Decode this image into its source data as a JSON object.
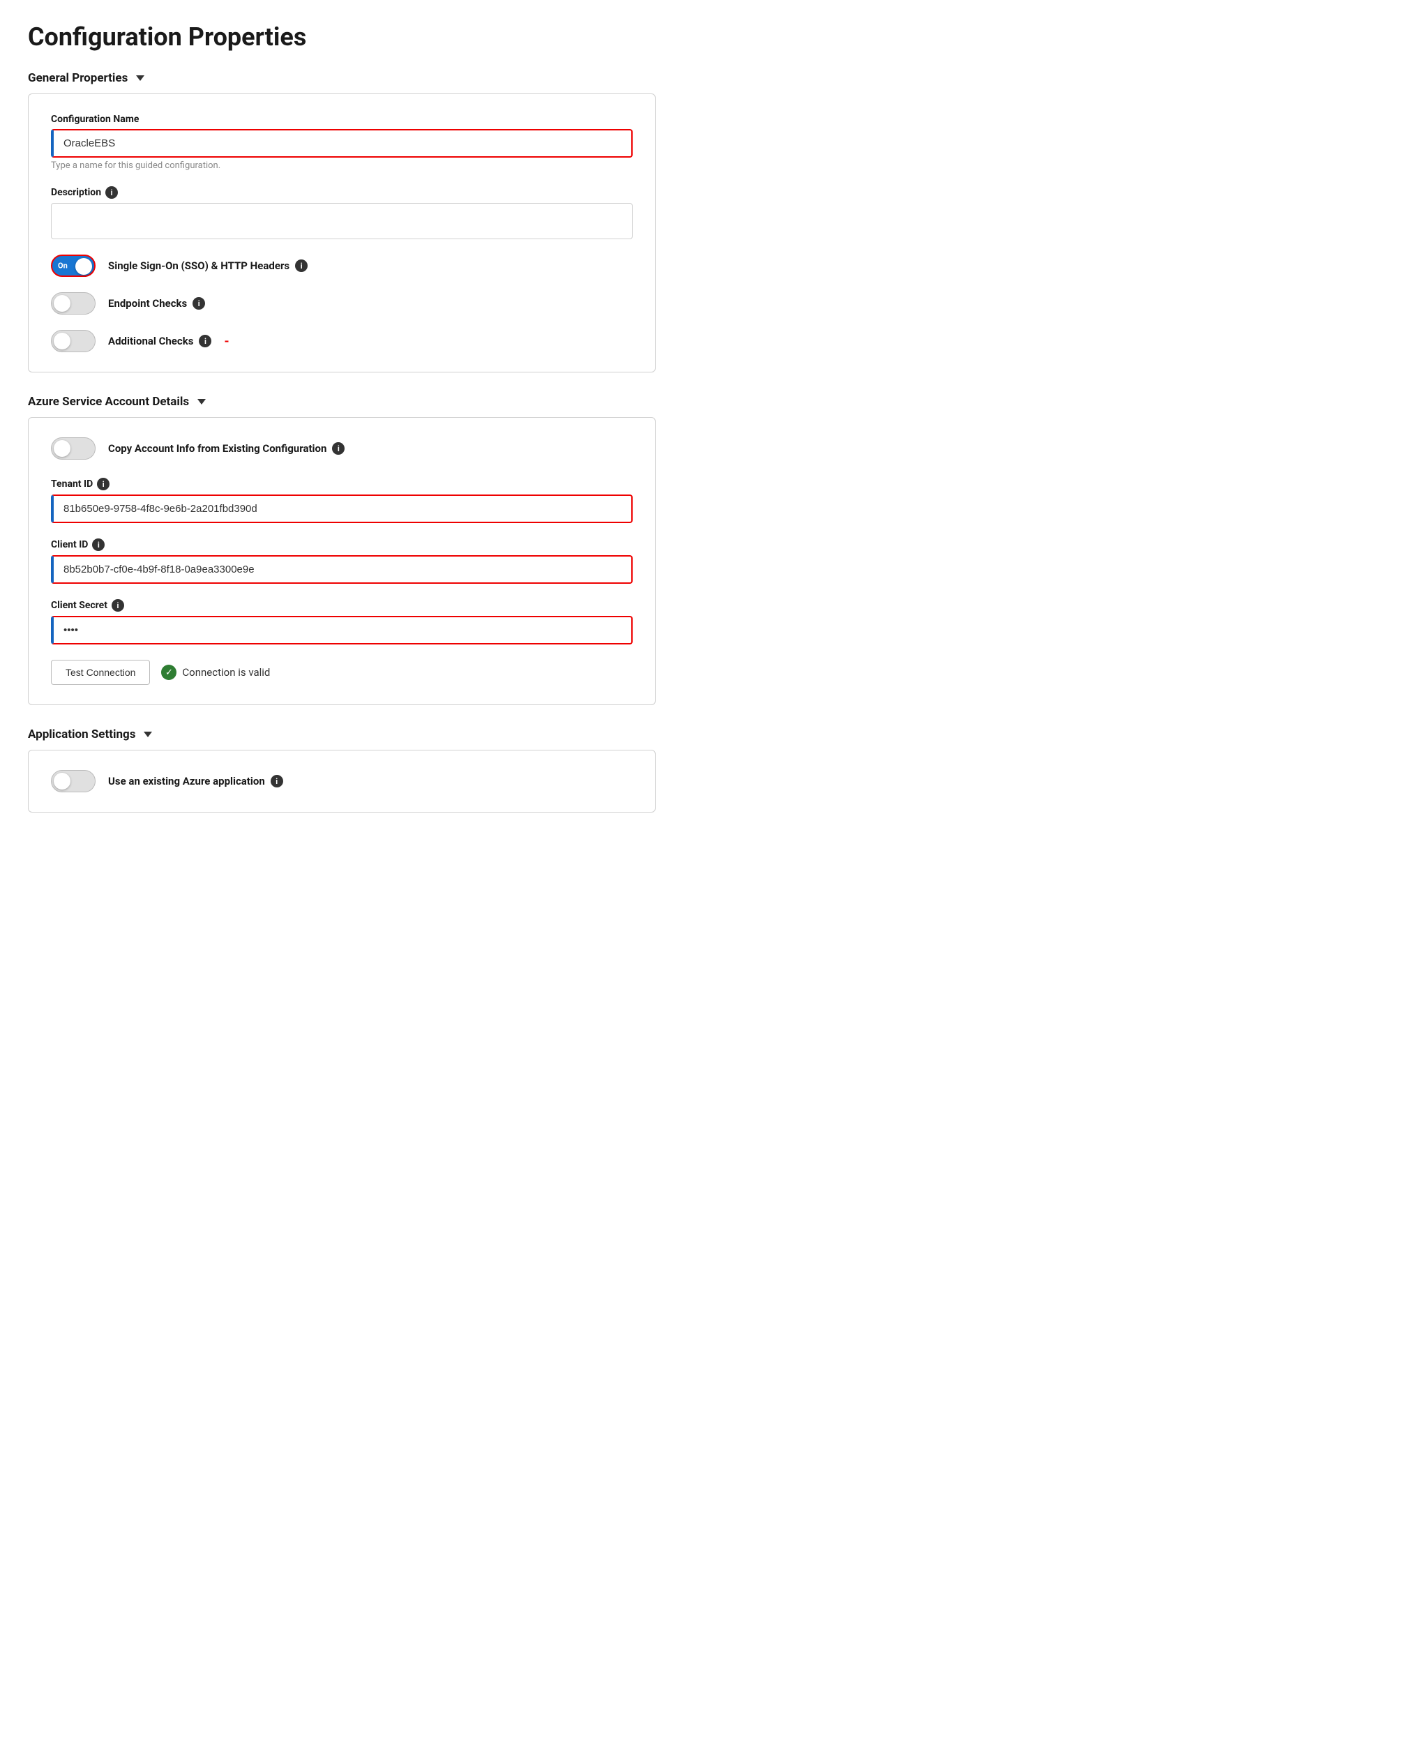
{
  "page": {
    "title": "Configuration Properties"
  },
  "general_properties": {
    "section_label": "General Properties",
    "config_name": {
      "label": "Configuration Name",
      "value": "OracleEBS",
      "hint": "Type a name for this guided configuration."
    },
    "description": {
      "label": "Description",
      "info": "i",
      "value": ""
    },
    "sso_toggle": {
      "label": "Single Sign-On (SSO) & HTTP Headers",
      "info": "i",
      "state": "on",
      "text": "On"
    },
    "endpoint_toggle": {
      "label": "Endpoint Checks",
      "info": "i",
      "state": "off"
    },
    "additional_toggle": {
      "label": "Additional Checks",
      "info": "i",
      "state": "off"
    }
  },
  "azure_details": {
    "section_label": "Azure Service Account Details",
    "copy_toggle": {
      "label": "Copy Account Info from Existing Configuration",
      "info": "i",
      "state": "off"
    },
    "tenant_id": {
      "label": "Tenant ID",
      "info": "i",
      "value": "81b650e9-9758-4f8c-9e6b-2a201fbd390d"
    },
    "client_id": {
      "label": "Client ID",
      "info": "i",
      "value": "8b52b0b7-cf0e-4b9f-8f18-0a9ea3300e9e"
    },
    "client_secret": {
      "label": "Client Secret",
      "info": "i",
      "value": "••••"
    },
    "test_btn_label": "Test Connection",
    "connection_valid_text": "Connection is valid",
    "check_icon": "✓"
  },
  "app_settings": {
    "section_label": "Application Settings",
    "azure_app_toggle": {
      "label": "Use an existing Azure application",
      "info": "i",
      "state": "off"
    }
  }
}
